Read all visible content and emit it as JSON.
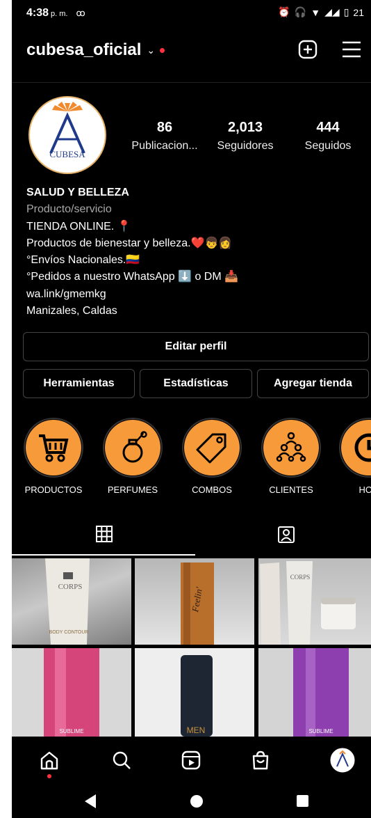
{
  "status_bar": {
    "time": "4:38",
    "ampm": "p. m.",
    "voicemail": "ꝏ",
    "battery": "21"
  },
  "header": {
    "username": "cubesa_oficial",
    "chevron": "⌄"
  },
  "profile": {
    "avatar_text": "CUBESA",
    "stats": [
      {
        "value": "86",
        "label": "Publicacion..."
      },
      {
        "value": "2,013",
        "label": "Seguidores"
      },
      {
        "value": "444",
        "label": "Seguidos"
      }
    ],
    "name": "SALUD Y BELLEZA",
    "category": "Producto/servicio",
    "bio_lines": [
      "TIENDA ONLINE. 📍",
      "Productos de bienestar y belleza.❤️👦👩",
      "°Envíos Nacionales.🇨🇴",
      "°Pedidos a nuestro WhatsApp ⬇️ o DM 📥"
    ],
    "link": "wa.link/gmemkg",
    "location": "Manizales, Caldas"
  },
  "buttons": {
    "edit_profile": "Editar perfil",
    "tools": "Herramientas",
    "insights": "Estadísticas",
    "add_shop": "Agregar tienda"
  },
  "highlights": [
    {
      "label": "PRODUCTOS",
      "icon": "cart-icon"
    },
    {
      "label": "PERFUMES",
      "icon": "perfume-icon"
    },
    {
      "label": "COMBOS",
      "icon": "tag-icon"
    },
    {
      "label": "CLIENTES",
      "icon": "people-icon"
    },
    {
      "label": "HOR",
      "icon": "clock-icon"
    }
  ],
  "grid_posts": [
    {
      "caption": "CORPS",
      "sub": "BODY CONTOUR"
    },
    {
      "caption": "Feelin'",
      "sub": ""
    },
    {
      "caption": "CORPS",
      "sub": ""
    },
    {
      "caption": "SUBLIME",
      "sub": ""
    },
    {
      "caption": "MEN",
      "sub": ""
    },
    {
      "caption": "SUBLIME",
      "sub": ""
    }
  ],
  "colors": {
    "background": "#000000",
    "highlight_orange": "#f79a3a",
    "notification_red": "#ff3040",
    "border": "#444444"
  }
}
